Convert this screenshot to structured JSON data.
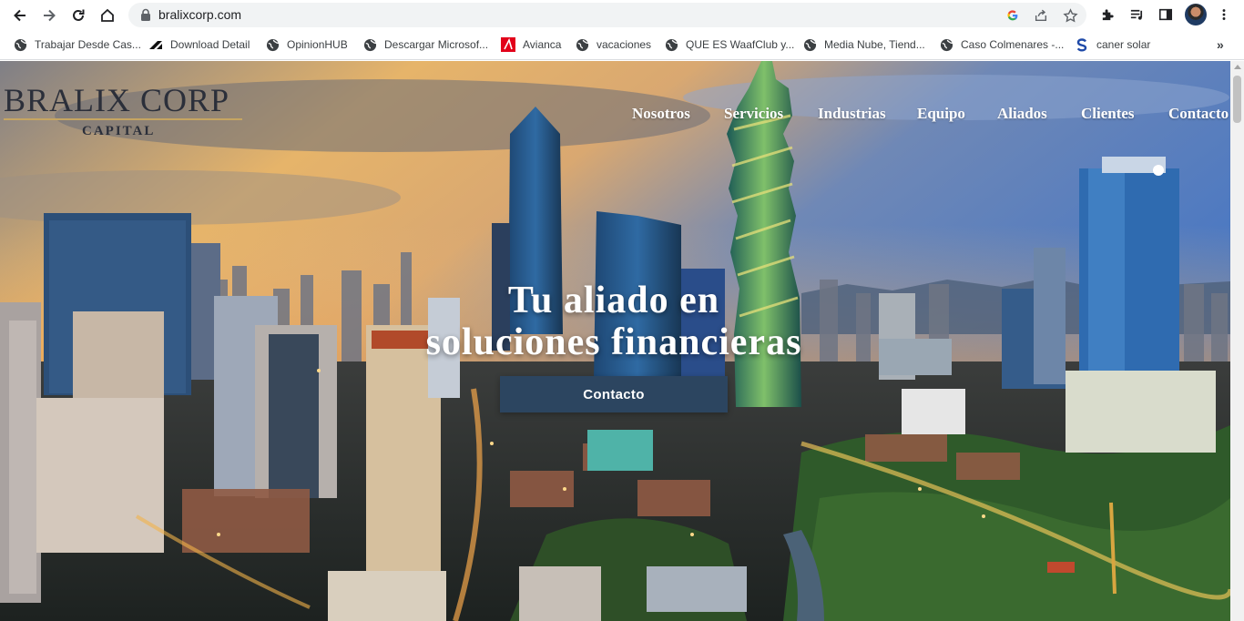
{
  "browser": {
    "url": "bralixcorp.com",
    "bookmarks": [
      {
        "label": "Trabajar Desde Cas...",
        "icon": "globe-icon"
      },
      {
        "label": "Download Detail",
        "icon": "stripe-logo-icon"
      },
      {
        "label": "OpinionHUB",
        "icon": "globe-icon"
      },
      {
        "label": "Descargar Microsof...",
        "icon": "globe-icon"
      },
      {
        "label": "Avianca",
        "icon": "avianca-logo-icon"
      },
      {
        "label": "vacaciones",
        "icon": "globe-icon"
      },
      {
        "label": "QUE ES WaafClub y...",
        "icon": "globe-icon"
      },
      {
        "label": "Media Nube, Tiend...",
        "icon": "globe-icon"
      },
      {
        "label": "Caso Colmenares -...",
        "icon": "globe-icon"
      },
      {
        "label": "caner solar",
        "icon": "s-logo-icon"
      }
    ],
    "more_bookmarks": "»"
  },
  "site": {
    "logo": {
      "title": "BRALIX  CORP",
      "subtitle": "CAPITAL"
    },
    "menu": [
      "Nosotros",
      "Servicios",
      "Industrias",
      "Equipo",
      "Aliados",
      "Clientes",
      "Contacto"
    ],
    "hero": {
      "headline_line1": "Tu aliado en",
      "headline_line2": "soluciones financieras",
      "cta_label": "Contacto"
    }
  },
  "colors": {
    "cta_bg": "#2c4560",
    "logo_text": "#2b2f3a",
    "logo_rule": "#c6a561"
  }
}
